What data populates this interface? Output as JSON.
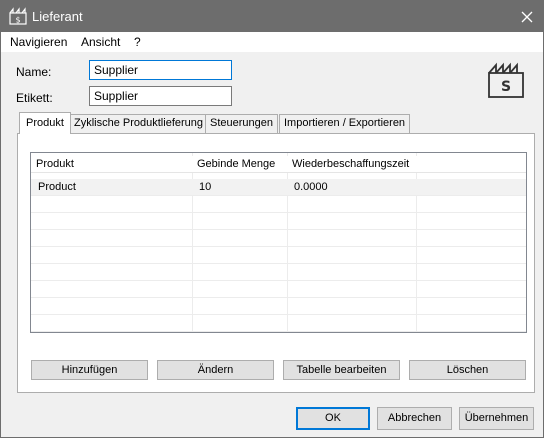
{
  "window": {
    "title": "Lieferant"
  },
  "menu": [
    "Navigieren",
    "Ansicht",
    "?"
  ],
  "form": {
    "name_label": "Name:",
    "name_value": "Supplier",
    "tag_label": "Etikett:",
    "tag_value": "Supplier"
  },
  "icon_letter": "S",
  "tabs": [
    "Produkt",
    "Zyklische Produktlieferung",
    "Steuerungen",
    "Importieren / Exportieren"
  ],
  "table": {
    "columns": [
      "Produkt",
      "Gebinde Menge",
      "Wiederbeschaffungszeit"
    ],
    "rows": [
      [
        "Product",
        "10",
        "0.0000"
      ]
    ]
  },
  "tab_buttons": [
    "Hinzufügen",
    "Ändern",
    "Tabelle bearbeiten",
    "Löschen"
  ],
  "dialog_buttons": [
    "OK",
    "Abbrechen",
    "Übernehmen"
  ],
  "colors": {
    "titlebar": "#6d6d6d",
    "focus": "#0078d7"
  }
}
